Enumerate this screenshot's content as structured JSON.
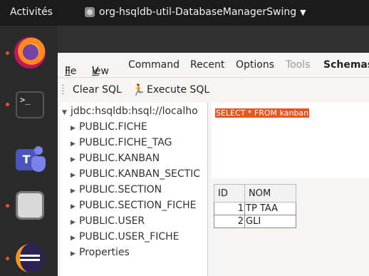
{
  "topbar": {
    "activities": "Activités",
    "app_name": "org-hsqldb-util-DatabaseManagerSwing",
    "caret": "▼"
  },
  "dock": {
    "items": [
      {
        "name": "Firefox",
        "running": true
      },
      {
        "name": "Terminal",
        "running": true,
        "glyph": ">_"
      },
      {
        "name": "Microsoft Teams",
        "running": false,
        "glyph": "T"
      },
      {
        "name": "Files",
        "running": true
      },
      {
        "name": "Eclipse",
        "running": true
      }
    ],
    "accent": "#e95420"
  },
  "menubar": {
    "file": "File",
    "view": "View",
    "command": "Command",
    "recent": "Recent",
    "options": "Options",
    "tools": "Tools",
    "schemas": "Schemas"
  },
  "toolbar": {
    "clear_sql": "Clear SQL",
    "execute_sql": "Execute SQL"
  },
  "tree": {
    "root": "jdbc:hsqldb:hsql://localho",
    "items": [
      "PUBLIC.FICHE",
      "PUBLIC.FICHE_TAG",
      "PUBLIC.KANBAN",
      "PUBLIC.KANBAN_SECTIC",
      "PUBLIC.SECTION",
      "PUBLIC.SECTION_FICHE",
      "PUBLIC.USER",
      "PUBLIC.USER_FICHE",
      "Properties"
    ]
  },
  "sql": {
    "query": "SELECT * FROM kanban",
    "highlight": "#e95420"
  },
  "results": {
    "columns": [
      "ID",
      "NOM"
    ],
    "rows": [
      [
        "1",
        "TP TAA"
      ],
      [
        "2",
        "GLI"
      ]
    ]
  }
}
